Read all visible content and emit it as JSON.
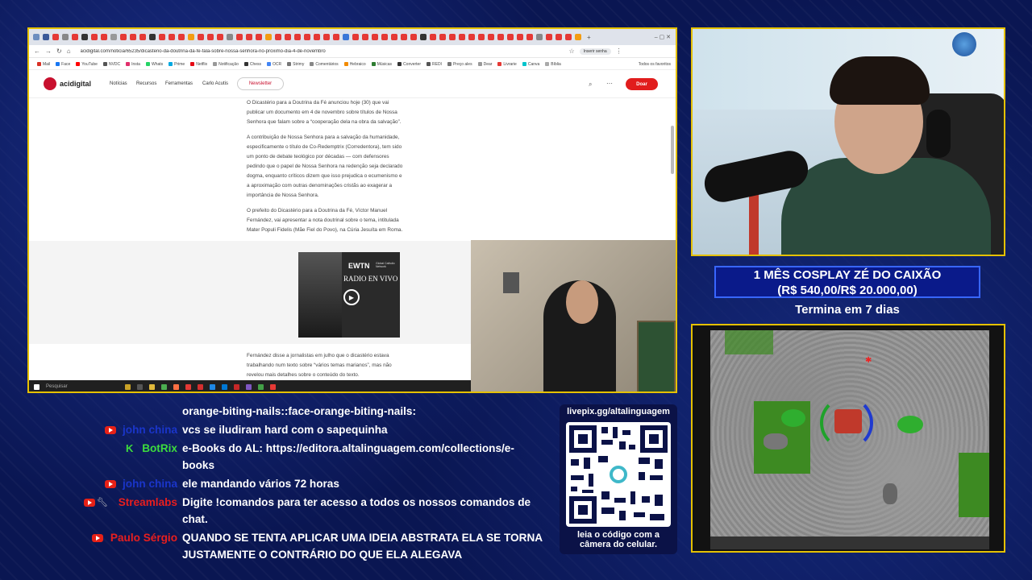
{
  "browser": {
    "url": "acidigital.com/noticia/65235/dicasterio-da-doutrina-da-fe-fala-sobre-nossa-senhora-no-proximo-dia-4-de-novembro",
    "profile_label": "Inserir senha",
    "bookmarks": [
      "Mail",
      "Face",
      "YouTube",
      "NVDC",
      "Insta",
      "Whats",
      "Prime",
      "Netflix",
      "Notificação",
      "Chess",
      "OCR",
      "Strimy",
      "Comentários",
      "Hebraico",
      "Músicas",
      "Converter",
      "REDI",
      "Preço ales",
      "Dear",
      "Livrarie",
      "Canva",
      "Bíblia"
    ],
    "bookmarks_other": "Todos os favoritos"
  },
  "site": {
    "logo": "acidigital",
    "menu": [
      "Notícias",
      "Recursos",
      "Ferramentas",
      "Carlo Acutis"
    ],
    "newsletter": "Newsletter",
    "donate": "Doar"
  },
  "article": {
    "p1_l1": "O Dicastério para a Doutrina da Fé anunciou hoje (30) que vai",
    "p1_l2": "publicar um documento em 4 de novembro sobre títulos de Nossa",
    "p1_l3": "Senhora que falam sobre a “cooperação dela na obra da salvação”.",
    "p2_l1": "A contribuição de Nossa Senhora para a salvação da humanidade,",
    "p2_l2": "especificamente o título de Co-Redemptrix (Corredentora), tem sido",
    "p2_l3": "um ponto de debate teológico por décadas — com defensores",
    "p2_l4": "pedindo que o papel de Nossa Senhora na redenção seja declarado",
    "p2_l5": "dogma, enquanto críticos dizem que isso prejudica o ecumenismo e",
    "p2_l6": "a aproximação com outras denominações cristãs ao exagerar a",
    "p2_l7": "importância de Nossa Senhora.",
    "p3_l1": "O prefeito do Dicastério para a Doutrina da Fé, Víctor Manuel",
    "p3_l2": "Fernández, vai apresentar a nota doutrinal sobre o tema, intitulada",
    "p3_l3": "Mater Populi Fidelis (Mãe Fiel do Povo), na Cúria Jesuíta em Roma.",
    "p4_l1": "Fernández disse a jornalistas em julho que o dicastério estava",
    "p4_l2": "trabalhando num texto sobre “vários temas marianos”, mas não",
    "p4_l3": "revelou mais detalhes sobre o conteúdo do texto."
  },
  "radio_ad": {
    "brand": "EWTN",
    "network": "Global Catholic Network",
    "title": "RADIO EN VIVO"
  },
  "taskbar": {
    "search_placeholder": "Pesquisar"
  },
  "goal": {
    "line1": "1 MÊS COSPLAY ZÉ DO CAIXÃO",
    "line2": "(R$ 540,00/R$ 20.000,00)",
    "line3": "Termina em 7 dias"
  },
  "chat": [
    {
      "user": "",
      "text": "orange-biting-nails::face-orange-biting-nails:"
    },
    {
      "user": "john china",
      "text": "vcs se iludiram hard com o sapequinha"
    },
    {
      "user": "BotRix",
      "text": "e-Books do AL: https://editora.altalinguagem.com/collections/e-",
      "text2": "books"
    },
    {
      "user": "john china",
      "text": "ele mandando vários 72 horas"
    },
    {
      "user": "Streamlabs",
      "text": "Digite !comandos para ter acesso a todos os nossos comandos de",
      "text2": "chat."
    },
    {
      "user": "Paulo Sérgio",
      "text": "QUANDO SE TENTA APLICAR UMA IDEIA ABSTRATA ELA SE TORNA",
      "text2": "JUSTAMENTE O CONTRÁRIO DO QUE ELA ALEGAVA"
    }
  ],
  "chat_colors": {
    "john": "#1a35c9",
    "botrix": "#3ddc3d",
    "streamlabs": "#e81e1e",
    "paulo": "#e81e1e"
  },
  "qr": {
    "url": "livepix.gg/altalinguagem",
    "caption1": "leia o código com a",
    "caption2": "câmera do celular."
  }
}
